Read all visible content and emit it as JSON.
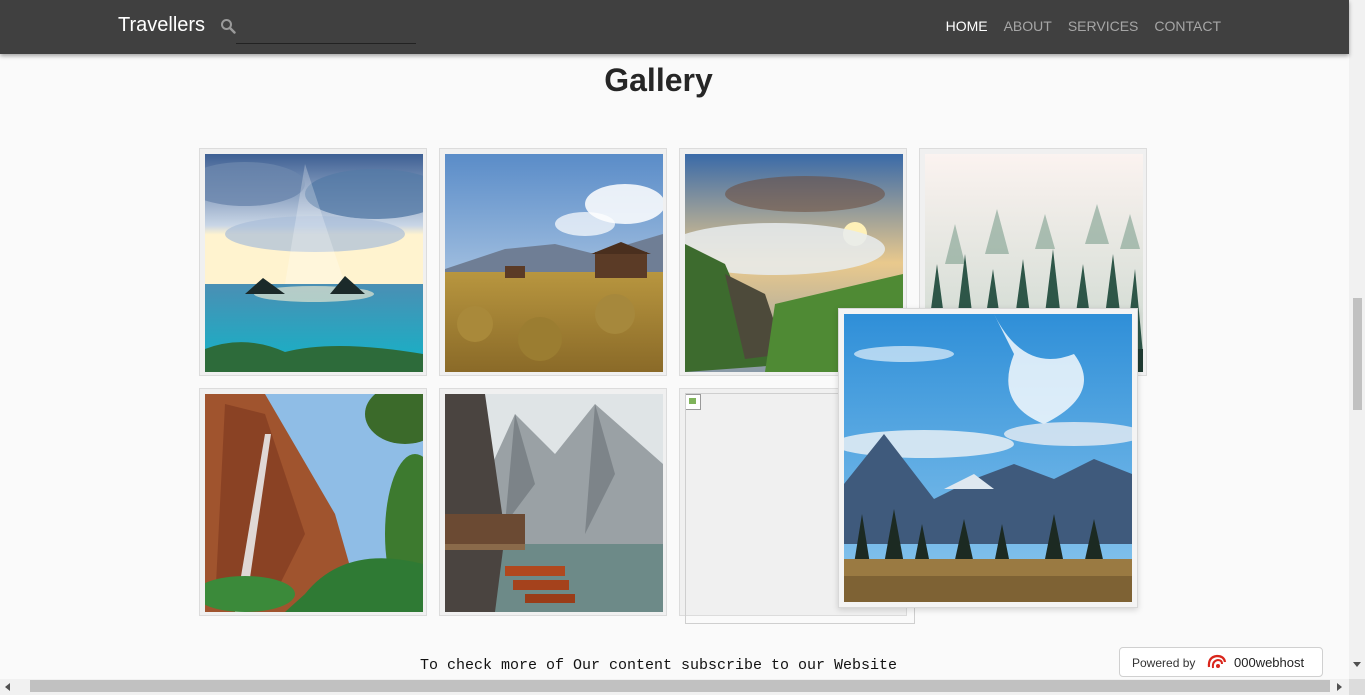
{
  "navbar": {
    "brand": "Travellers",
    "search_icon": "search-icon",
    "search_value": "",
    "links": [
      "HOME",
      "ABOUT",
      "SERVICES",
      "CONTACT"
    ],
    "active_link": "HOME"
  },
  "gallery": {
    "title": "Gallery",
    "images": [
      "ocean-sunrays-islands",
      "desert-cabin-mountains",
      "cliff-sunset-clouds",
      "misty-pine-forest",
      "red-rock-waterfall",
      "lake-boats-dolomites",
      "broken-image",
      "blue-sky-mountains-enlarged"
    ]
  },
  "footer": {
    "subscribe_text": "To check more of Our content subscribe to our Website"
  },
  "badge": {
    "label": "Powered by",
    "brand": "000webhost",
    "logo_icon": "000webhost-logo-icon"
  },
  "colors": {
    "navbar_bg": "#404040",
    "nav_active": "#ffffff",
    "nav_inactive": "#a6a6a6",
    "page_bg": "#fafafa"
  }
}
